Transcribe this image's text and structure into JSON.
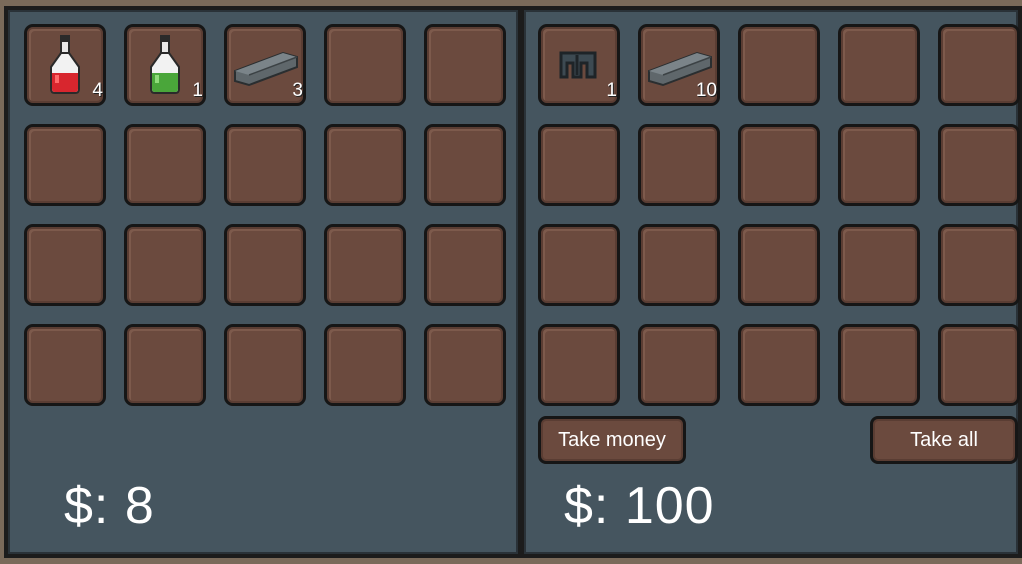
{
  "left_inventory": {
    "slots": [
      {
        "item": "red-potion-icon",
        "count": "4"
      },
      {
        "item": "green-potion-icon",
        "count": "1"
      },
      {
        "item": "iron-bar-icon",
        "count": "3"
      },
      {},
      {},
      {},
      {},
      {},
      {},
      {},
      {},
      {},
      {},
      {},
      {},
      {},
      {},
      {},
      {},
      {}
    ],
    "money": "$: 8"
  },
  "right_inventory": {
    "slots": [
      {
        "item": "pants-icon",
        "count": "1"
      },
      {
        "item": "iron-bar-icon",
        "count": "10"
      },
      {},
      {},
      {},
      {},
      {},
      {},
      {},
      {},
      {},
      {},
      {},
      {},
      {},
      {},
      {},
      {},
      {},
      {}
    ],
    "money": "$: 100",
    "take_money_label": "Take money",
    "take_all_label": "Take all"
  },
  "colors": {
    "panel": "#45555f",
    "slot": "#6b4a3e",
    "potion_red": "#d8262e",
    "potion_green": "#4aa63a",
    "iron": "#5f676b"
  }
}
